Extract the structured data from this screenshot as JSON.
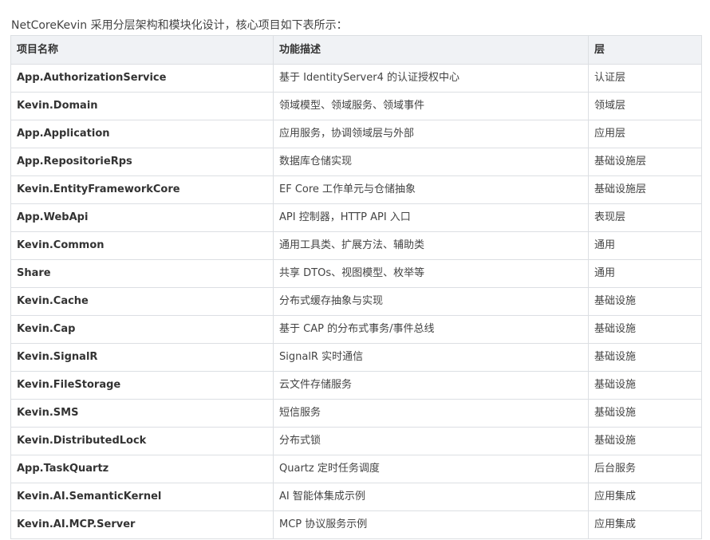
{
  "intro_text": "NetCoreKevin 采用分层架构和模块化设计，核心项目如下表所示：",
  "table": {
    "headers": [
      "项目名称",
      "功能描述",
      "层"
    ],
    "rows": [
      {
        "name": "App.AuthorizationService",
        "desc": "基于 IdentityServer4 的认证授权中心",
        "layer": "认证层"
      },
      {
        "name": "Kevin.Domain",
        "desc": "领域模型、领域服务、领域事件",
        "layer": "领域层"
      },
      {
        "name": "App.Application",
        "desc": "应用服务，协调领域层与外部",
        "layer": "应用层"
      },
      {
        "name": "App.RepositorieRps",
        "desc": "数据库仓储实现",
        "layer": "基础设施层"
      },
      {
        "name": "Kevin.EntityFrameworkCore",
        "desc": "EF Core 工作单元与仓储抽象",
        "layer": "基础设施层"
      },
      {
        "name": "App.WebApi",
        "desc": "API 控制器，HTTP API 入口",
        "layer": "表现层"
      },
      {
        "name": "Kevin.Common",
        "desc": "通用工具类、扩展方法、辅助类",
        "layer": "通用"
      },
      {
        "name": "Share",
        "desc": "共享 DTOs、视图模型、枚举等",
        "layer": "通用"
      },
      {
        "name": "Kevin.Cache",
        "desc": "分布式缓存抽象与实现",
        "layer": "基础设施"
      },
      {
        "name": "Kevin.Cap",
        "desc": "基于 CAP 的分布式事务/事件总线",
        "layer": "基础设施"
      },
      {
        "name": "Kevin.SignalR",
        "desc": "SignalR 实时通信",
        "layer": "基础设施"
      },
      {
        "name": "Kevin.FileStorage",
        "desc": "云文件存储服务",
        "layer": "基础设施"
      },
      {
        "name": "Kevin.SMS",
        "desc": "短信服务",
        "layer": "基础设施"
      },
      {
        "name": "Kevin.DistributedLock",
        "desc": "分布式锁",
        "layer": "基础设施"
      },
      {
        "name": "App.TaskQuartz",
        "desc": "Quartz 定时任务调度",
        "layer": "后台服务"
      },
      {
        "name": "Kevin.AI.SemanticKernel",
        "desc": "AI 智能体集成示例",
        "layer": "应用集成"
      },
      {
        "name": "Kevin.AI.MCP.Server",
        "desc": "MCP 协议服务示例",
        "layer": "应用集成"
      }
    ]
  }
}
